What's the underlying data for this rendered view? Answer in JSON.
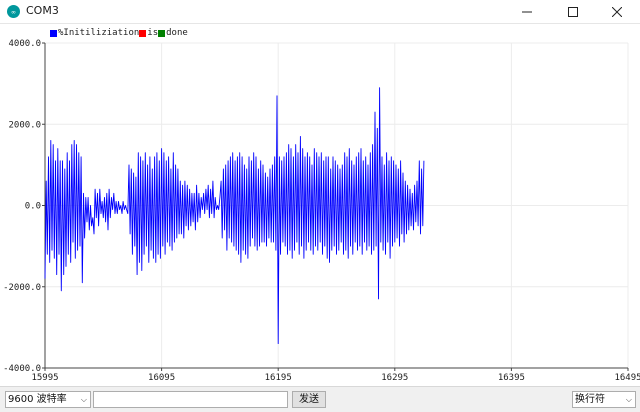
{
  "window": {
    "title": "COM3",
    "minimize_icon": "minimize-icon",
    "maximize_icon": "maximize-icon",
    "close_icon": "close-icon"
  },
  "legend": [
    {
      "label": "%Initiliziation",
      "color": "#0000ff"
    },
    {
      "label": "is",
      "color": "#ff0000"
    },
    {
      "label": "done",
      "color": "#008000"
    }
  ],
  "toolbar": {
    "baud_value": "9600 波特率",
    "send_input_value": "",
    "send_label": "发送",
    "line_ending_value": "换行符"
  },
  "chart_data": {
    "type": "line",
    "xlim": [
      15995,
      16495
    ],
    "ylim": [
      -4000,
      4000
    ],
    "x_ticks": [
      "15995",
      "16095",
      "16195",
      "16295",
      "16395",
      "16495"
    ],
    "y_ticks": [
      "4000.0",
      "2000.0",
      "0.0",
      "-2000.0",
      "-4000.0"
    ],
    "grid": true,
    "series": [
      {
        "color": "#0000ff",
        "x_start": 15995,
        "x_step": 1,
        "values": [
          -1800,
          600,
          -1200,
          1200,
          -1400,
          1600,
          -1100,
          1500,
          -1300,
          1100,
          -1700,
          1400,
          -1200,
          1100,
          -2100,
          1100,
          -1700,
          900,
          -1500,
          1300,
          -1200,
          1100,
          -1400,
          1500,
          -900,
          1600,
          -1300,
          1500,
          -1100,
          1300,
          -1000,
          1200,
          -1900,
          300,
          -800,
          200,
          -400,
          200,
          -600,
          0,
          -500,
          -300,
          -700,
          400,
          -300,
          300,
          -500,
          400,
          -200,
          100,
          -300,
          200,
          -400,
          300,
          -600,
          400,
          -300,
          200,
          -100,
          300,
          -200,
          100,
          -200,
          100,
          -100,
          0,
          -200,
          100,
          -100,
          0,
          -100,
          -200,
          1000,
          -700,
          900,
          -1200,
          800,
          -1000,
          700,
          -1700,
          1300,
          -1400,
          1200,
          -1600,
          1100,
          -1200,
          1300,
          -1000,
          1000,
          -1400,
          1200,
          -1100,
          900,
          -1300,
          1200,
          -1400,
          1300,
          -1200,
          1100,
          -1300,
          1400,
          -1000,
          1300,
          -1200,
          1100,
          -900,
          1200,
          -1000,
          900,
          -1100,
          1300,
          -900,
          1000,
          -800,
          900,
          -700,
          600,
          -700,
          500,
          -800,
          600,
          -500,
          500,
          -600,
          400,
          -500,
          300,
          -400,
          300,
          -600,
          500,
          -400,
          300,
          -300,
          200,
          -100,
          300,
          -200,
          400,
          -100,
          500,
          -300,
          400,
          -200,
          600,
          -300,
          200,
          -100,
          0,
          -100,
          200,
          600,
          -800,
          900,
          -600,
          1000,
          -1100,
          1100,
          -800,
          1200,
          -900,
          1300,
          -1000,
          1100,
          -1100,
          1200,
          -1200,
          1300,
          -1400,
          1200,
          -1100,
          1000,
          -1200,
          900,
          -1300,
          1200,
          -1000,
          1100,
          -800,
          1300,
          -1000,
          1200,
          -1100,
          900,
          -1000,
          1100,
          -900,
          1000,
          -900,
          800,
          -1000,
          700,
          -800,
          900,
          -900,
          1000,
          -900,
          1200,
          -1100,
          2700,
          -3400,
          1200,
          -1200,
          1100,
          -900,
          1200,
          -1000,
          1300,
          -1200,
          1500,
          -1100,
          1400,
          -1300,
          1200,
          -1100,
          1500,
          -900,
          1300,
          -1200,
          1700,
          -1000,
          1400,
          -1300,
          1200,
          -1100,
          1300,
          -900,
          1200,
          -1100,
          1000,
          -1200,
          1400,
          -1000,
          1300,
          -1100,
          1200,
          -900,
          1300,
          -1200,
          1100,
          -1000,
          1200,
          -1300,
          1200,
          -1400,
          900,
          -1100,
          1200,
          -1000,
          1100,
          -1200,
          1000,
          -1100,
          900,
          -900,
          1000,
          -1200,
          1300,
          -1100,
          1200,
          -1300,
          1400,
          -1000,
          1100,
          -1200,
          1000,
          -900,
          1200,
          -1100,
          1300,
          -1000,
          1400,
          -1200,
          1100,
          -900,
          1200,
          -1100,
          1000,
          -1000,
          1300,
          -1200,
          1500,
          -1100,
          2300,
          -1000,
          1900,
          -2300,
          2900,
          -900,
          1200,
          -1100,
          1000,
          -1200,
          1300,
          -900,
          1100,
          -1300,
          1200,
          -1000,
          1100,
          -900,
          1000,
          -800,
          900,
          -1000,
          1100,
          -700,
          800,
          -900,
          600,
          -700,
          500,
          -600,
          400,
          -500,
          300,
          -600,
          500,
          -400,
          600,
          -500,
          1100,
          -700,
          900,
          -500,
          1100
        ]
      }
    ]
  }
}
